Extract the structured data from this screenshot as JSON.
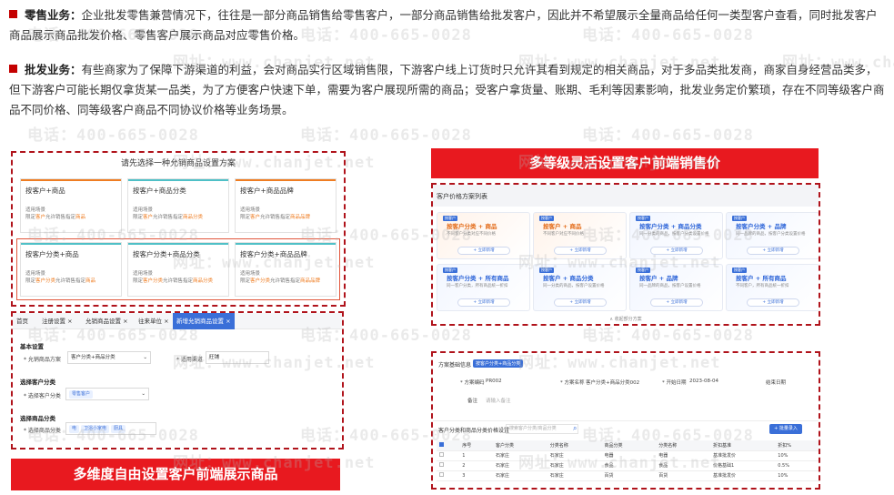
{
  "intro": {
    "retail_title": "零售业务：",
    "retail_text": "企业批发零售兼营情况下，往往是一部分商品销售给零售客户，一部分商品销售给批发客户，因此并不希望展示全量商品给任何一类型客户查看，同时批发客户商品展示商品批发价格、零售客户展示商品对应零售价格。",
    "wholesale_title": "批发业务：",
    "wholesale_text": "有些商家为了保障下游渠道的利益，会对商品实行区域销售限，下游客户线上订货时只允许其看到规定的相关商品，对于多品类批发商，商家自身经营品类多，但下游客户可能长期仅拿货某一品类，为了方便客户快速下单，需要为客户展现所需的商品；受客户拿货量、账期、毛利等因素影响，批发业务定价繁琐，存在不同等级客户商品不同价格、同等级客户商品不同协议价格等业务场景。",
    "accent": "#c40000"
  },
  "watermarks": {
    "phone": "电话：400-665-0028",
    "site": "网址：www.chanjet.net"
  },
  "banners": {
    "left": "多维度自由设置客户前端展示商品",
    "right": "多等级灵活设置客户前端销售价",
    "color": "#e8191f"
  },
  "scheme_panel": {
    "title": "请先选择一种允销商品设置方案",
    "cards": [
      {
        "title": "按客户+商品",
        "scene": "适用场景",
        "desc": "限定",
        "hl1": "客户",
        "mid": "允许销售指定",
        "hl2": "商品"
      },
      {
        "title": "按客户+商品分类",
        "scene": "适用场景",
        "desc": "限定",
        "hl1": "客户",
        "mid": "允许销售指定",
        "hl2": "商品分类"
      },
      {
        "title": "按客户+商品品牌",
        "scene": "适用场景",
        "desc": "限定",
        "hl1": "客户",
        "mid": "允许销售指定",
        "hl2": "商品品牌"
      },
      {
        "title": "按客户分类+商品",
        "scene": "适用场景",
        "desc": "限定",
        "hl1": "客户分类",
        "mid": "允许销售指定",
        "hl2": "商品"
      },
      {
        "title": "按客户分类+商品分类",
        "scene": "适用场景",
        "desc": "限定",
        "hl1": "客户分类",
        "mid": "允许销售指定",
        "hl2": "商品分类"
      },
      {
        "title": "按客户分类+商品品牌",
        "scene": "适用场景",
        "desc": "限定",
        "hl1": "客户分类",
        "mid": "允许销售指定",
        "hl2": "商品品牌"
      }
    ]
  },
  "settings_panel": {
    "tabs": [
      "首页",
      "注册设置 ×",
      "允销商品设置 ×",
      "往来单位 ×",
      "新增允销商品设置 ×"
    ],
    "basic_title": "基本设置",
    "scheme_label": "* 允销商品方案",
    "scheme_value": "客户分类+商品分类",
    "channel_label": "* 适用渠道",
    "channel_value": "旺铺",
    "cust_title": "选择客户分类",
    "cust_label": "* 选择客户分类",
    "cust_chip": "零售客户",
    "goods_title": "选择商品分类",
    "goods_label": "* 选择商品分类",
    "goods_chips": [
      "电",
      "卫浴小家电",
      "厨具"
    ]
  },
  "price_panel": {
    "title": "客户价格方案列表",
    "cards": [
      {
        "badge": "按客户",
        "title": "按客户分类 + 商品",
        "desc": "不同客户分类对应不同价格",
        "btn": "+ 立即新增",
        "orange": true
      },
      {
        "badge": "按客户",
        "title": "按客户 + 商品",
        "desc": "不同客户对应不同价格",
        "btn": "+ 立即新增",
        "orange": true
      },
      {
        "badge": "按客户",
        "title": "按客户分类 + 商品分类",
        "desc": "同一分类的商品，按客户分类设置价格",
        "btn": "+ 立即新增",
        "orange": false
      },
      {
        "badge": "按客户",
        "title": "按客户分类 + 品牌",
        "desc": "同一品牌的商品，按客户分类设置价格",
        "btn": "+ 立即新增",
        "orange": false
      },
      {
        "badge": "按客户",
        "title": "按客户分类 + 所有商品",
        "desc": "同一客户分类，所有商品统一折扣",
        "btn": "+ 立即新增",
        "orange": false
      },
      {
        "badge": "按客户",
        "title": "按客户 + 商品分类",
        "desc": "同一分类的商品，按客户设置价格",
        "btn": "+ 立即新增",
        "orange": false
      },
      {
        "badge": "按客户",
        "title": "按客户 + 品牌",
        "desc": "同一品牌的商品，按客户设置价格",
        "btn": "+ 立即新增",
        "orange": false
      },
      {
        "badge": "按客户",
        "title": "按客户 + 所有商品",
        "desc": "不同客户，所有商品统一折扣",
        "btn": "+ 立即新增",
        "orange": false
      }
    ],
    "footer": "收起部分方案"
  },
  "detail_panel": {
    "info_title": "方案基础信息",
    "info_tag": "按客户分类+商品分类",
    "code_label": "* 方案编码",
    "code_value": "PR002",
    "name_label": "* 方案名称",
    "name_value": "客户分类+商品分类002",
    "start_label": "* 开始日期",
    "start_value": "2023-08-04",
    "end_label": "结束日期",
    "note_label": "备注",
    "note_placeholder": "请输入备注",
    "grid_title": "客户分类和商品分类价格设置",
    "search_placeholder": "搜索客户分类/商品分类",
    "batch_button": "+ 批量录入",
    "columns": [
      "序号",
      "客户分类",
      "分类名称",
      "商品分类",
      "分类名称",
      "折扣基准",
      "折扣%"
    ],
    "rows": [
      [
        "1",
        "石家庄",
        "石家庄",
        "电器",
        "电器",
        "基准批发价",
        "10%"
      ],
      [
        "2",
        "石家庄",
        "石家庄",
        "食品",
        "食品",
        "价格基础1",
        "0.5%"
      ],
      [
        "3",
        "石家庄",
        "石家庄",
        "百货",
        "百货",
        "基准批发价",
        "10%"
      ]
    ]
  }
}
